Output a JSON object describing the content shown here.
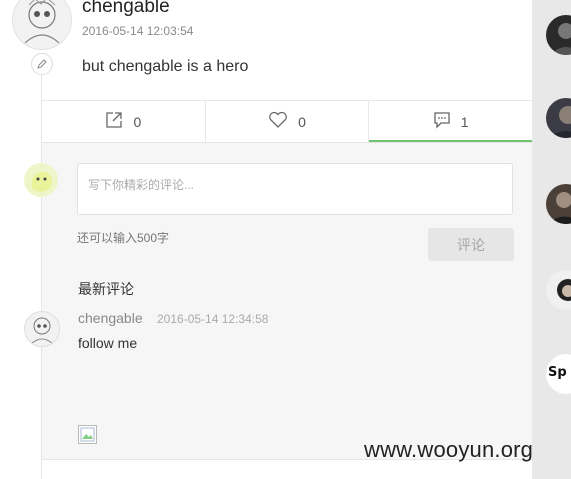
{
  "post": {
    "author": "chengable",
    "time": "2016-05-14 12:03:54",
    "text": "but chengable is a hero"
  },
  "actions": {
    "share_count": "0",
    "like_count": "0",
    "comment_count": "1"
  },
  "comment_box": {
    "placeholder": "写下你精彩的评论...",
    "remaining": "还可以输入500字",
    "submit_label": "评论"
  },
  "latest": {
    "title": "最新评论",
    "comments": [
      {
        "author": "chengable",
        "time": "2016-05-14 12:34:58",
        "text": "follow me"
      }
    ]
  },
  "sidebar": {
    "avatars": [
      {
        "name": "user-avatar-1",
        "color": "#2a2a2a"
      },
      {
        "name": "user-avatar-2",
        "color": "#3b3b46"
      },
      {
        "name": "user-avatar-3",
        "color": "#4a4038"
      },
      {
        "name": "user-avatar-4",
        "color": "#f0f0f0"
      },
      {
        "name": "user-avatar-5",
        "color": "#ffffff",
        "label": "Sp"
      }
    ]
  },
  "watermark": "www.wooyun.org",
  "colors": {
    "accent": "#6fc26f",
    "comment_bg": "#f6f6f6",
    "button_bg": "#e6e6e6"
  }
}
